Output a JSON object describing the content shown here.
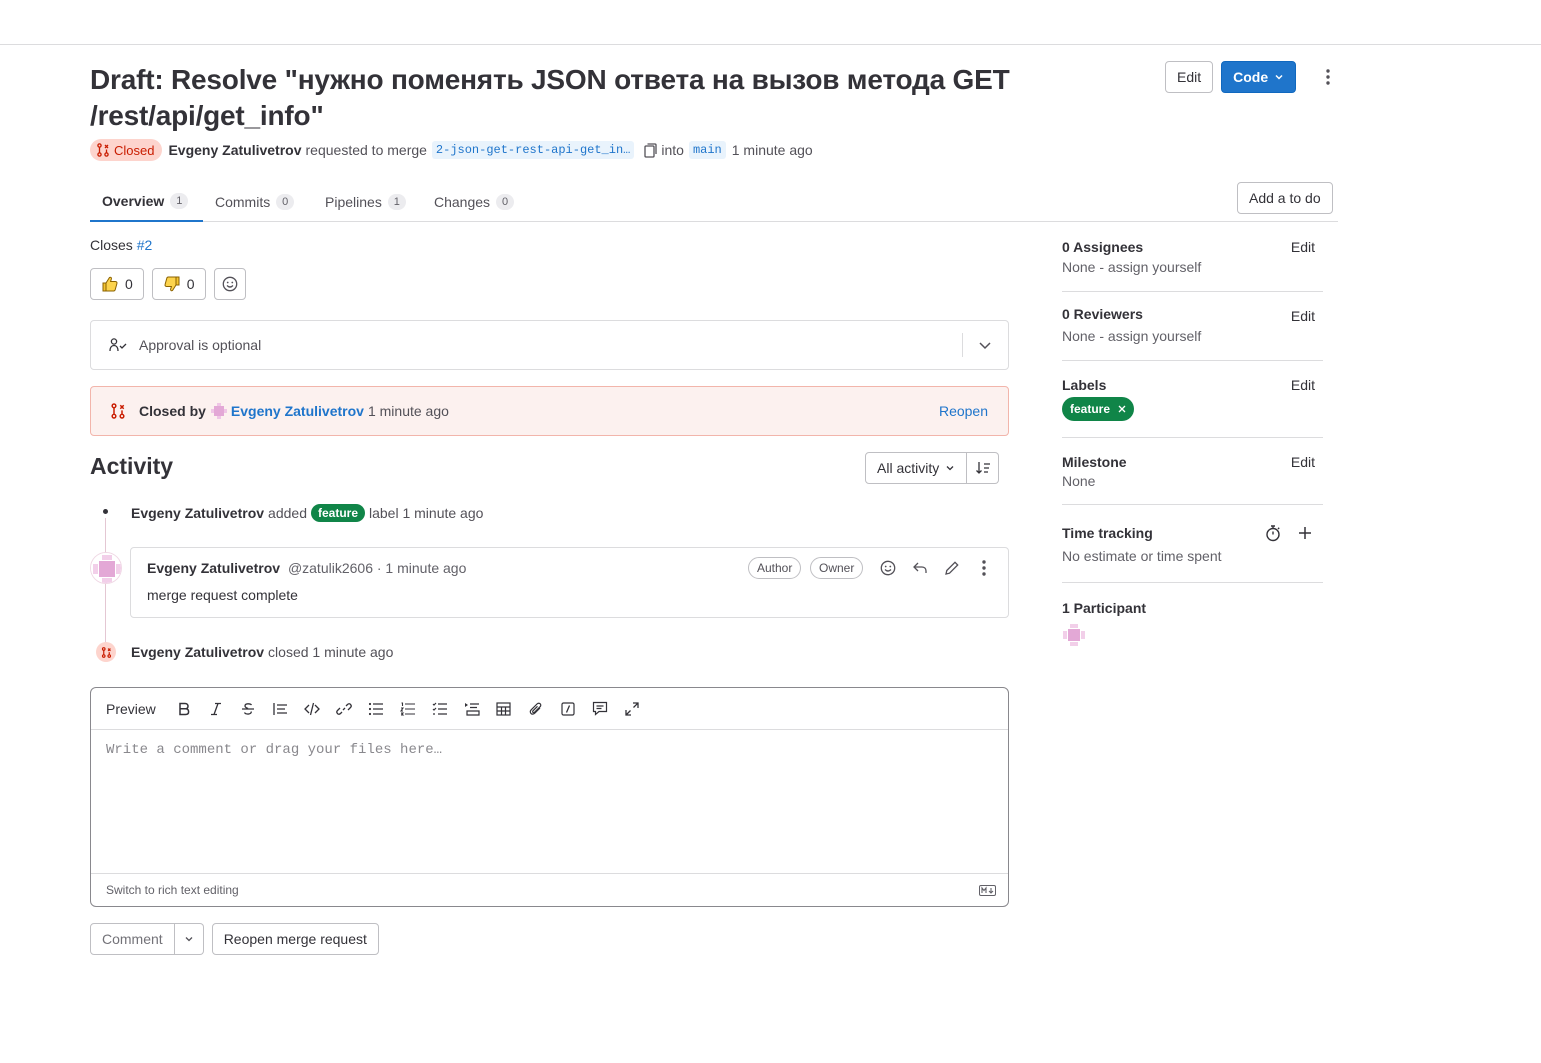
{
  "header": {
    "title": "Draft: Resolve \"нужно поменять JSON ответа на вызов метода GET /rest/api/get_info\"",
    "edit_label": "Edit",
    "code_label": "Code"
  },
  "meta": {
    "status": "Closed",
    "author": "Evgeny Zatulivetrov",
    "requested_text": "requested to merge",
    "source_branch": "2-json-get-rest-api-get_in…",
    "into_text": "into",
    "target_branch": "main",
    "time": "1 minute ago"
  },
  "tabs": [
    {
      "label": "Overview",
      "count": "1"
    },
    {
      "label": "Commits",
      "count": "0"
    },
    {
      "label": "Pipelines",
      "count": "1"
    },
    {
      "label": "Changes",
      "count": "0"
    }
  ],
  "todo_label": "Add a to do",
  "closes": {
    "prefix": "Closes",
    "issue": "#2"
  },
  "reactions": {
    "thumbs_up": "0",
    "thumbs_down": "0"
  },
  "approval_text": "Approval is optional",
  "closed_banner": {
    "closed_by": "Closed by",
    "user": "Evgeny Zatulivetrov",
    "time": "1 minute ago",
    "reopen": "Reopen"
  },
  "activity": {
    "title": "Activity",
    "filter": "All activity",
    "notes": [
      {
        "user": "Evgeny Zatulivetrov",
        "action": "added",
        "label": "feature",
        "suffix": "label 1 minute ago"
      },
      {
        "user": "Evgeny Zatulivetrov",
        "action": "closed 1 minute ago"
      }
    ],
    "comment": {
      "user": "Evgeny Zatulivetrov",
      "meta": "@zatulik2606 · 1 minute ago",
      "body": "merge request complete",
      "role_author": "Author",
      "role_owner": "Owner"
    }
  },
  "editor": {
    "preview": "Preview",
    "placeholder": "Write a comment or drag your files here…",
    "switch": "Switch to rich text editing"
  },
  "actions": {
    "comment": "Comment",
    "reopen": "Reopen merge request"
  },
  "sidebar": {
    "assignees": {
      "title": "0 Assignees",
      "value": "None - assign yourself",
      "edit": "Edit"
    },
    "reviewers": {
      "title": "0 Reviewers",
      "value": "None - assign yourself",
      "edit": "Edit"
    },
    "labels": {
      "title": "Labels",
      "label": "feature",
      "edit": "Edit"
    },
    "milestone": {
      "title": "Milestone",
      "value": "None",
      "edit": "Edit"
    },
    "time_tracking": {
      "title": "Time tracking",
      "value": "No estimate or time spent"
    },
    "participants": {
      "title": "1 Participant"
    }
  },
  "colors": {
    "primary": "#1f75cb",
    "closed_bg": "#fdd4cd",
    "closed_text": "#c91c00",
    "label_green": "#108548"
  }
}
